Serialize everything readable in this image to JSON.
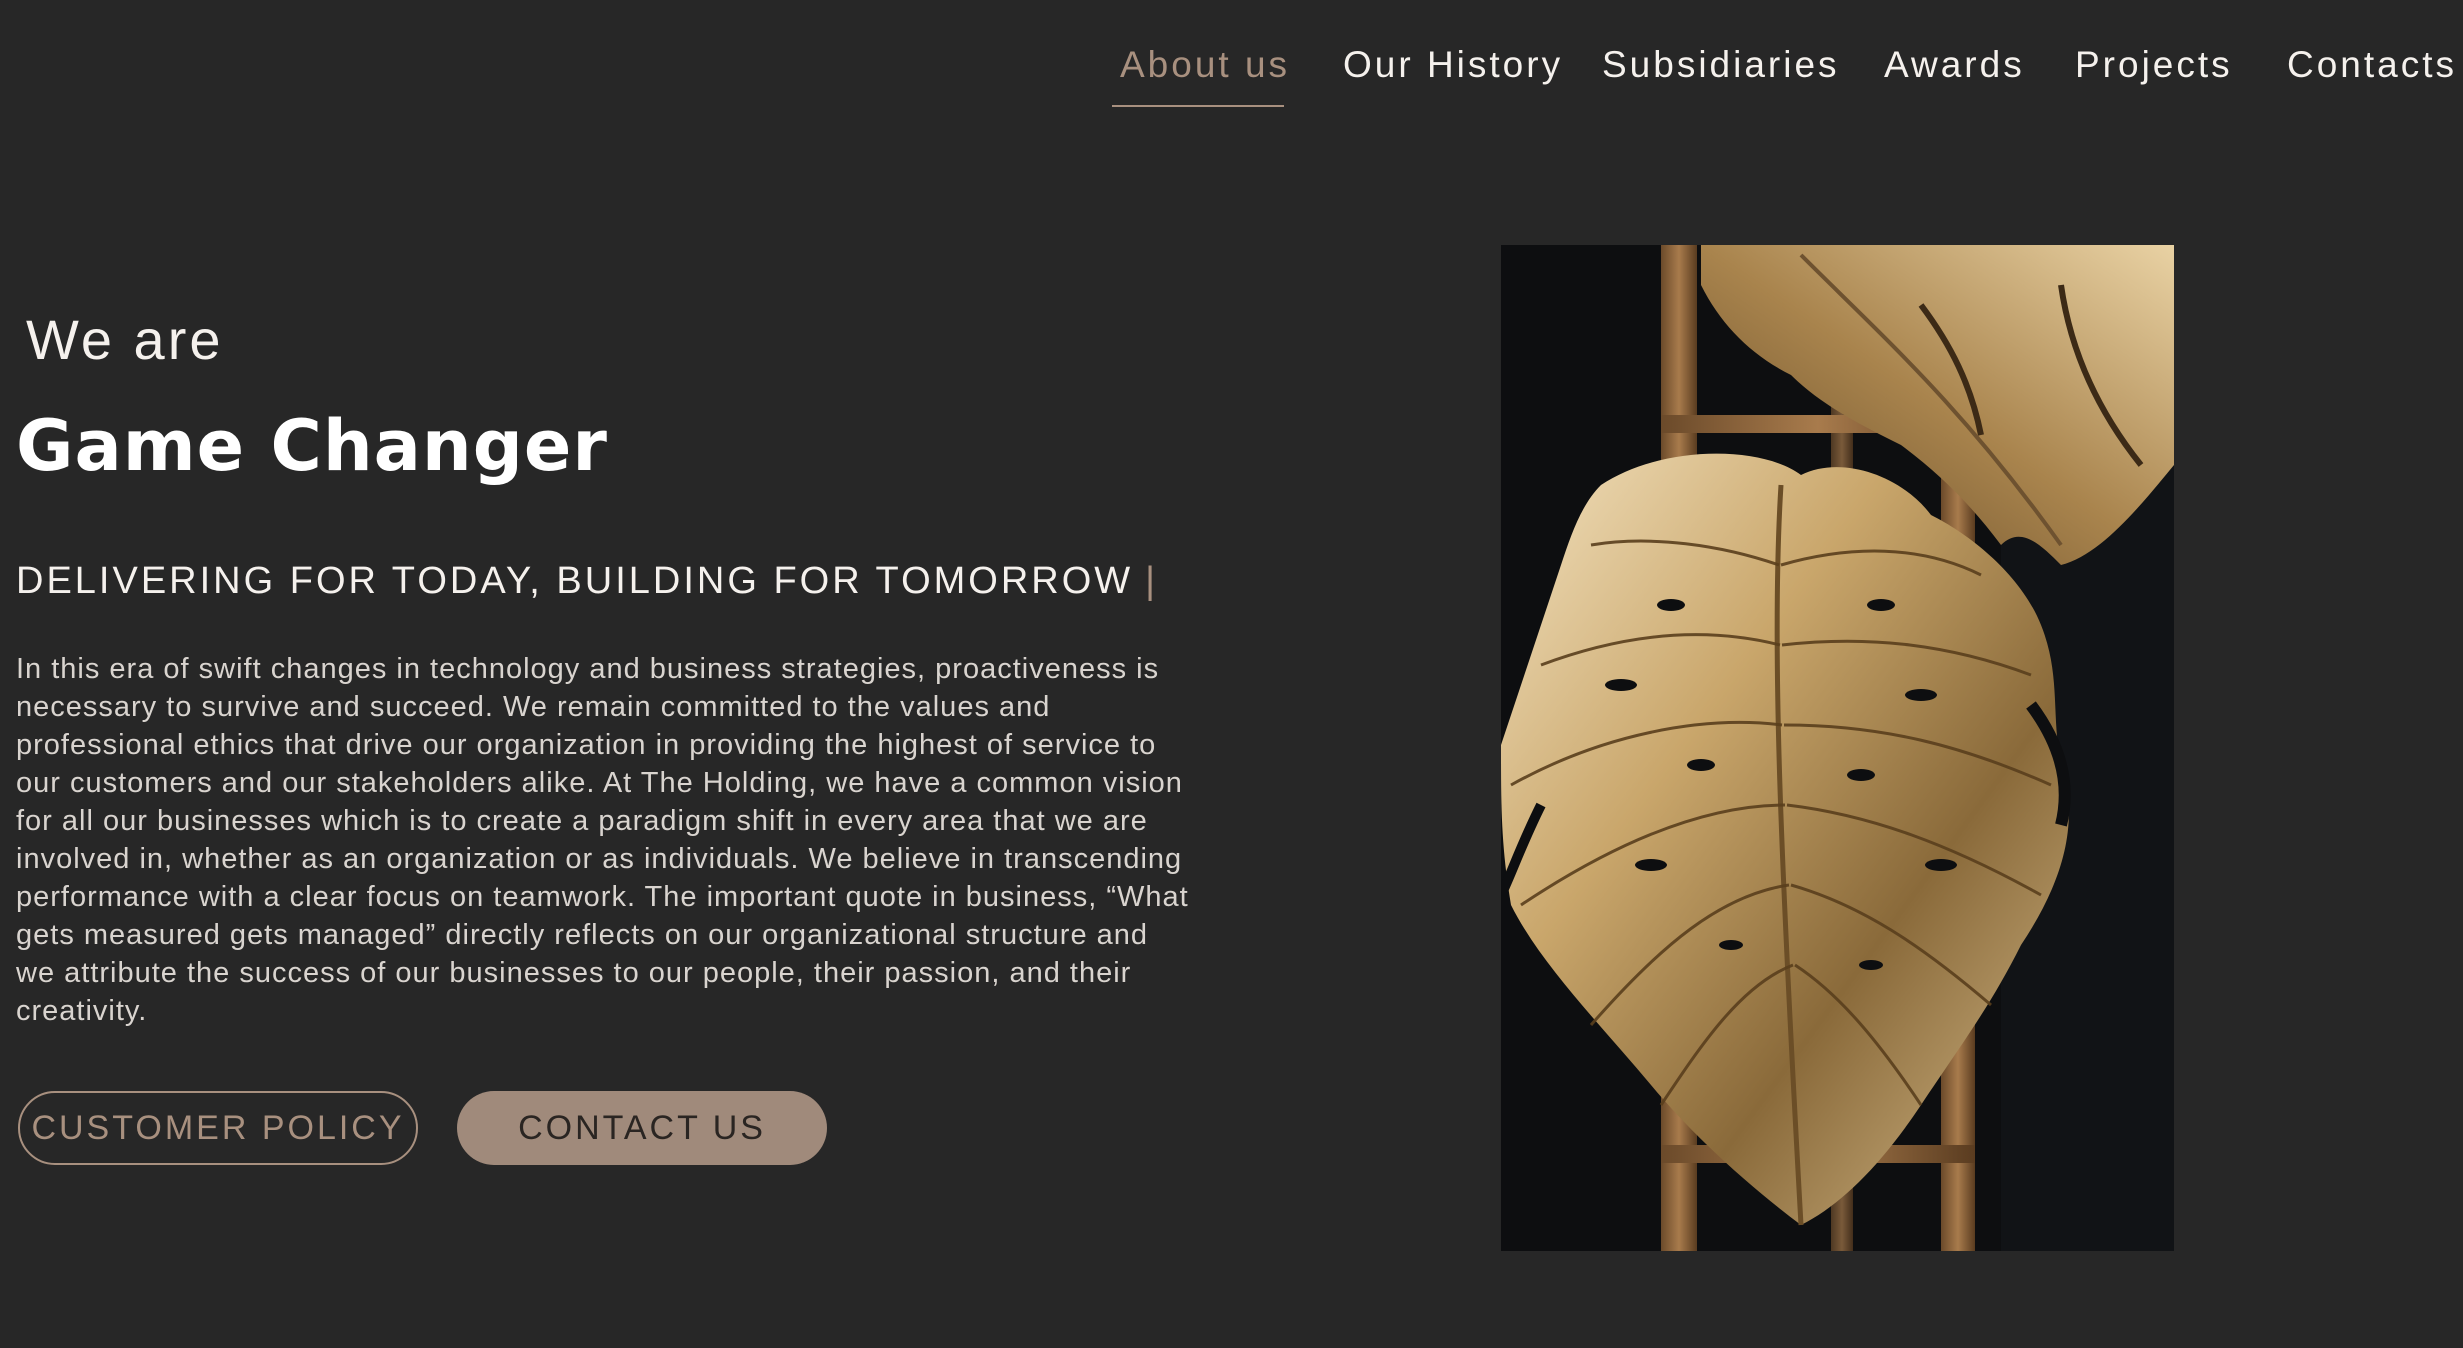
{
  "nav": {
    "items": [
      {
        "label": "About us",
        "active": true
      },
      {
        "label": "Our History",
        "active": false
      },
      {
        "label": "Subsidiaries",
        "active": false
      },
      {
        "label": "Awards",
        "active": false
      },
      {
        "label": "Projects",
        "active": false
      },
      {
        "label": "Contacts",
        "active": false
      }
    ]
  },
  "hero": {
    "intro": "We are",
    "headline": "Game Changer",
    "tagline": "DELIVERING FOR TODAY, BUILDING FOR TOMORROW",
    "tagline_cursor": "|",
    "body": "In this era of swift changes in technology and business strategies, proactiveness is necessary to survive and succeed. We remain committed to the values and professional ethics that drive our organization in providing the highest of service to our customers and our stakeholders alike. At The Holding, we have a common vision for all our businesses which is to create a paradigm shift in every area that we are involved in, whether as an organization or as individuals. We believe in transcending performance with a clear focus on teamwork. The important quote in business, “What gets measured gets managed” directly reflects on our organizational structure and we attribute the success of our businesses to our people, their passion, and their creativity."
  },
  "buttons": {
    "customer_policy": "CUSTOMER POLICY",
    "contact_us": "CONTACT US"
  },
  "colors": {
    "background": "#272727",
    "accent": "#a8907f",
    "button_fill": "#a08a7b"
  },
  "image": {
    "subject": "golden monstera leaves on wooden trellis"
  }
}
